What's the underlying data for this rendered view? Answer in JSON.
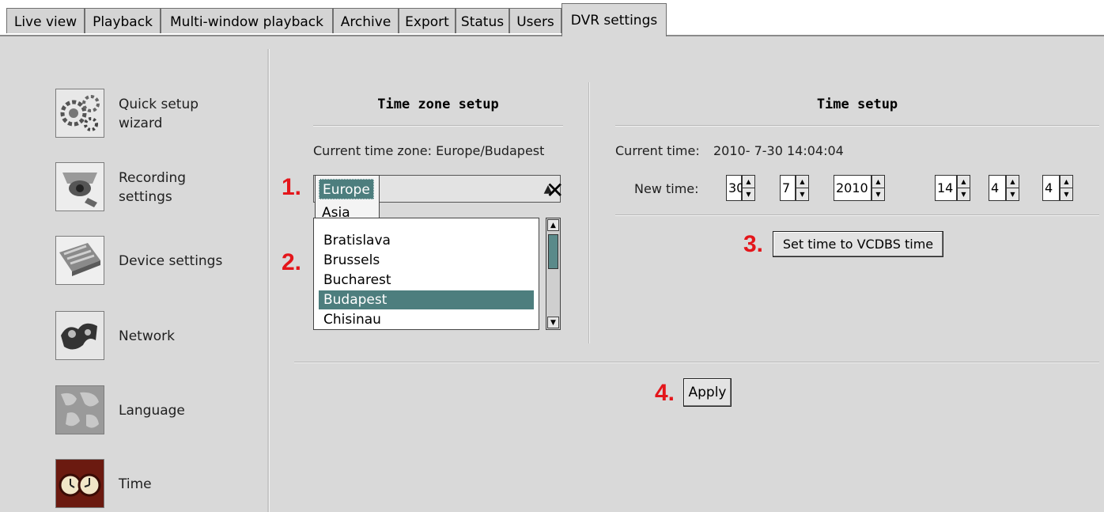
{
  "tabs": [
    {
      "label": "Live view"
    },
    {
      "label": "Playback"
    },
    {
      "label": "Multi-window playback"
    },
    {
      "label": "Archive"
    },
    {
      "label": "Export"
    },
    {
      "label": "Status"
    },
    {
      "label": "Users"
    },
    {
      "label": "DVR settings",
      "active": true
    }
  ],
  "sidebar": {
    "items": [
      {
        "label_line1": "Quick setup",
        "label_line2": "wizard",
        "icon": "gears-icon"
      },
      {
        "label_line1": "Recording",
        "label_line2": "settings",
        "icon": "camera-icon"
      },
      {
        "label": "Device settings",
        "icon": "device-board-icon"
      },
      {
        "label": "Network",
        "icon": "network-puzzle-icon"
      },
      {
        "label": "Language",
        "icon": "world-map-icon"
      },
      {
        "label": "Time",
        "icon": "clock-icon"
      }
    ]
  },
  "timezone": {
    "title": "Time zone setup",
    "current_label": "Current time zone: Europe/Budapest",
    "region_options": [
      "Europe",
      "Asia"
    ],
    "region_selected": "Europe",
    "cities": [
      "Bratislava",
      "Brussels",
      "Bucharest",
      "Budapest",
      "Chisinau"
    ],
    "city_selected": "Budapest"
  },
  "timesetup": {
    "title": "Time setup",
    "current_label": "Current time:",
    "current_value": "2010- 7-30 14:04:04",
    "new_label": "New time:",
    "day": "30",
    "month": "7",
    "year": "2010",
    "hour": "14",
    "minute": "4",
    "second": "4",
    "set_button": "Set time to VCDBS time"
  },
  "apply_button": "Apply",
  "markers": [
    "1.",
    "2.",
    "3.",
    "4."
  ],
  "colors": {
    "selection": "#4d7e7e",
    "marker": "#e4161b"
  }
}
